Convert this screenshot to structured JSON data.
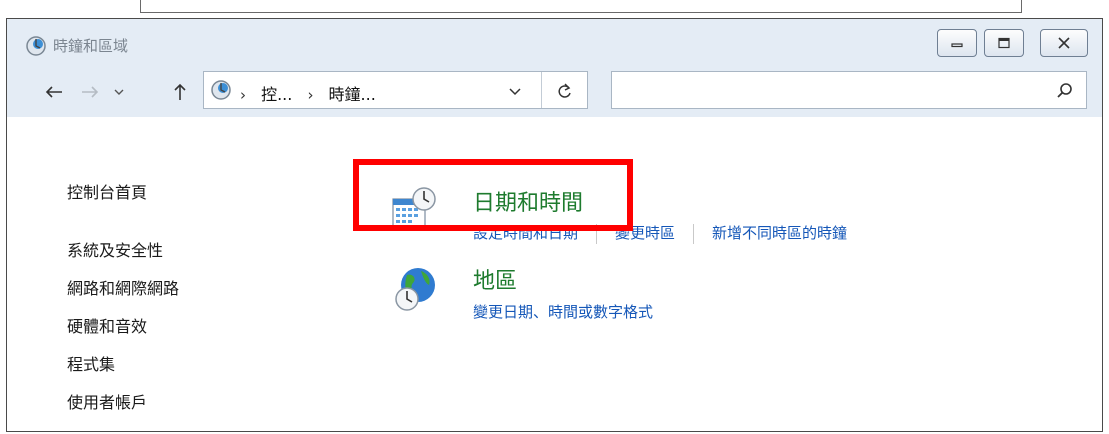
{
  "window": {
    "title": "時鐘和區域"
  },
  "address": {
    "crumbs": [
      "控...",
      "時鐘..."
    ],
    "separator": "›"
  },
  "search": {
    "placeholder": ""
  },
  "sidebar": {
    "items": [
      {
        "label": "控制台首頁"
      },
      {
        "label": "系統及安全性"
      },
      {
        "label": "網路和網際網路"
      },
      {
        "label": "硬體和音效"
      },
      {
        "label": "程式集"
      },
      {
        "label": "使用者帳戶"
      }
    ]
  },
  "categories": [
    {
      "title": "日期和時間",
      "icon": "calendar-clock-icon",
      "links": [
        "設定時間和日期",
        "變更時區",
        "新增不同時區的時鐘"
      ]
    },
    {
      "title": "地區",
      "icon": "globe-clock-icon",
      "links": [
        "變更日期、時間或數字格式"
      ]
    }
  ],
  "colors": {
    "category_title": "#1e7b2e",
    "link": "#1557b8",
    "highlight": "#ff0000",
    "titlebar": "#e4ecf5"
  }
}
